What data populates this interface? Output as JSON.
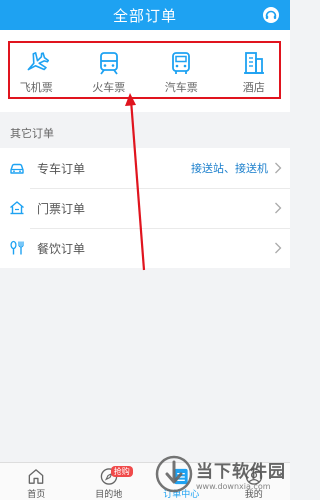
{
  "header": {
    "title": "全部订单"
  },
  "categories": [
    {
      "label": "飞机票",
      "icon": "plane-icon"
    },
    {
      "label": "火车票",
      "icon": "train-icon"
    },
    {
      "label": "汽车票",
      "icon": "bus-icon"
    },
    {
      "label": "酒店",
      "icon": "hotel-icon"
    }
  ],
  "other_orders": {
    "title": "其它订单",
    "rows": [
      {
        "label": "专车订单",
        "extra": "接送站、接送机",
        "icon": "car-icon"
      },
      {
        "label": "门票订单",
        "extra": "",
        "icon": "ticket-house-icon"
      },
      {
        "label": "餐饮订单",
        "extra": "",
        "icon": "utensils-icon"
      }
    ]
  },
  "tabbar": {
    "items": [
      {
        "label": "首页",
        "icon": "home-icon"
      },
      {
        "label": "目的地",
        "icon": "compass-icon",
        "badge": "抢购"
      },
      {
        "label": "订单中心",
        "icon": "order-center-icon",
        "active": true
      },
      {
        "label": "我的",
        "icon": "profile-icon"
      }
    ]
  },
  "watermark": {
    "title": "当下软件园",
    "url": "www.downxia.com"
  },
  "colors": {
    "primary": "#1ea2f2",
    "highlight_box": "#e0141e",
    "link": "#1b7fcc",
    "badge": "#f04a4a"
  }
}
